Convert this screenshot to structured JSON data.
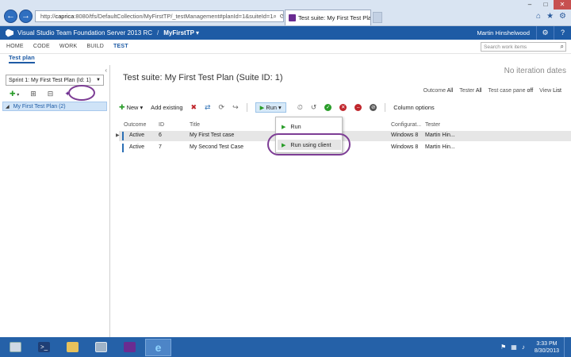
{
  "browser": {
    "back_glyph": "←",
    "forward_glyph": "→",
    "address_host": "caprica",
    "address_rest": ":8080/tfs/DefaultCollection/MyFirstTP/_testManagement#planId=1&suiteId=1",
    "tab_title": "Test suite: My First Test Pla...",
    "tab_close": "×",
    "window_controls": [
      "–",
      "□",
      "✕"
    ],
    "right_icons": [
      "⌂",
      "★",
      "⚙"
    ]
  },
  "header": {
    "product": "Visual Studio Team Foundation Server 2013 RC",
    "separator": "/",
    "project": "MyFirstTP ▾",
    "user": "Martin Hinshelwood",
    "gear": "⚙",
    "help": "?"
  },
  "hubs": [
    "HOME",
    "CODE",
    "WORK",
    "BUILD",
    "TEST"
  ],
  "active_hub": "TEST",
  "search": {
    "placeholder": "Search work items"
  },
  "subnav": {
    "active": "Test plan"
  },
  "left_pane": {
    "collapse": "‹",
    "plan_select": "Sprint 1: My First Test Plan (Id: 1)",
    "caret": "▼",
    "suite": "My First Test Plan (2)",
    "suite_expander": "◢"
  },
  "right_pane": {
    "iteration_info": "No iteration dates",
    "suite_title": "Test suite: My First Test Plan (Suite ID: 1)",
    "filters": [
      {
        "label": "Outcome",
        "value": "All"
      },
      {
        "label": "Tester",
        "value": "All"
      },
      {
        "label": "Test case pane",
        "value": "off"
      },
      {
        "label": "View",
        "value": "List"
      }
    ],
    "toolbar": {
      "new_label": "New ▾",
      "add_existing": "Add existing",
      "run_label": "Run ▾",
      "column_options": "Column options"
    },
    "columns": [
      "Outcome",
      "ID",
      "Title",
      "Configurat...",
      "Tester"
    ],
    "rows": [
      {
        "outcome": "Active",
        "id": "6",
        "title": "My First Test case",
        "config": "Windows 8",
        "tester": "Martin Hin..."
      },
      {
        "outcome": "Active",
        "id": "7",
        "title": "My Second Test Case",
        "config": "Windows 8",
        "tester": "Martin Hin..."
      }
    ],
    "run_menu": [
      "Run",
      "Run using client"
    ]
  },
  "taskbar": {
    "clock_time": "3:33 PM",
    "clock_date": "8/30/2013"
  },
  "colors": {
    "header_blue": "#1e5ba5",
    "accent_purple": "#6a2c91",
    "annotation_purple": "#7d3d95",
    "green": "#2a9d2a",
    "red": "#c0262c"
  }
}
